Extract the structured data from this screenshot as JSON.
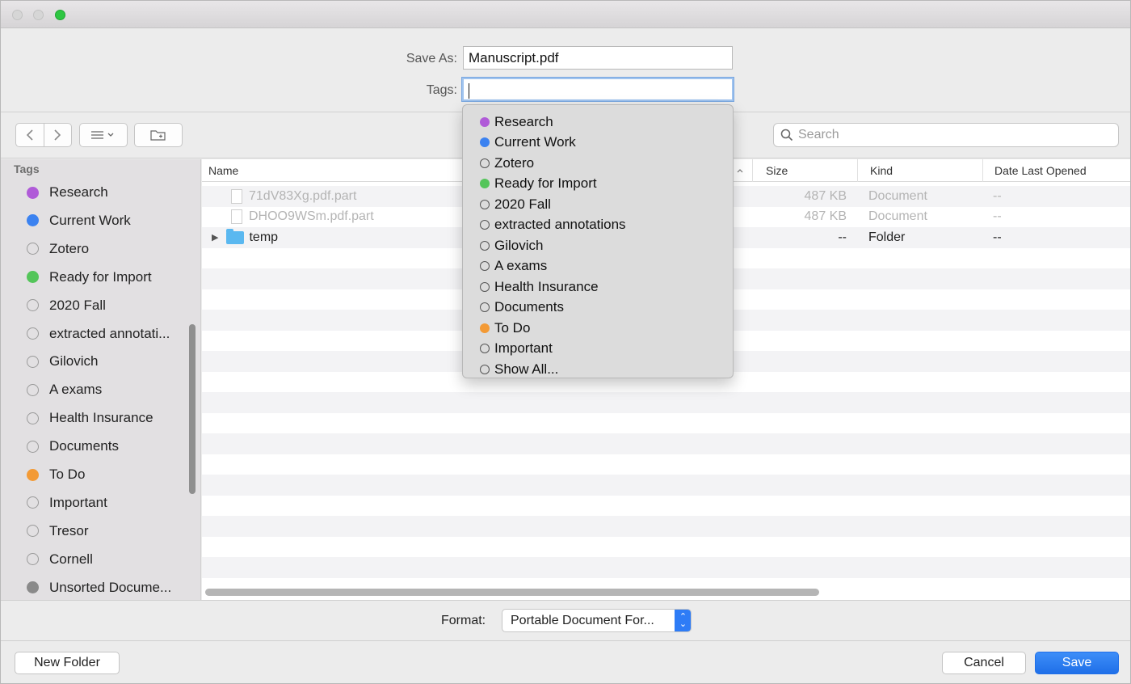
{
  "header": {
    "save_as_label": "Save As:",
    "save_as_value": "Manuscript.pdf",
    "tags_label": "Tags:",
    "tags_value": ""
  },
  "toolbar": {
    "search_placeholder": "Search"
  },
  "sidebar": {
    "title": "Tags",
    "items": [
      {
        "label": "Research",
        "color": "#b05bd8"
      },
      {
        "label": "Current Work",
        "color": "#3b82f0"
      },
      {
        "label": "Zotero",
        "color": ""
      },
      {
        "label": "Ready for Import",
        "color": "#54c55a"
      },
      {
        "label": "2020 Fall",
        "color": ""
      },
      {
        "label": "extracted annotati...",
        "color": ""
      },
      {
        "label": "Gilovich",
        "color": ""
      },
      {
        "label": "A exams",
        "color": ""
      },
      {
        "label": "Health Insurance",
        "color": ""
      },
      {
        "label": "Documents",
        "color": ""
      },
      {
        "label": "To Do",
        "color": "#f39a35"
      },
      {
        "label": "Important",
        "color": ""
      },
      {
        "label": "Tresor",
        "color": ""
      },
      {
        "label": "Cornell",
        "color": ""
      },
      {
        "label": "Unsorted Docume...",
        "color": "#8a8a8a"
      }
    ]
  },
  "columns": {
    "name": "Name",
    "size": "Size",
    "kind": "Kind",
    "date": "Date Last Opened"
  },
  "files": [
    {
      "name": "71dV83Xg.pdf.part",
      "size": "487 KB",
      "kind": "Document",
      "date": "--",
      "type": "file",
      "dimmed": true
    },
    {
      "name": "DHOO9WSm.pdf.part",
      "size": "487 KB",
      "kind": "Document",
      "date": "--",
      "type": "file",
      "dimmed": true
    },
    {
      "name": "temp",
      "size": "--",
      "kind": "Folder",
      "date": "--",
      "type": "folder",
      "dimmed": false
    }
  ],
  "tag_popup": {
    "items": [
      {
        "label": "Research",
        "color": "#b05bd8"
      },
      {
        "label": "Current Work",
        "color": "#3b82f0"
      },
      {
        "label": "Zotero",
        "color": ""
      },
      {
        "label": "Ready for Import",
        "color": "#54c55a"
      },
      {
        "label": "2020 Fall",
        "color": ""
      },
      {
        "label": "extracted annotations",
        "color": ""
      },
      {
        "label": "Gilovich",
        "color": ""
      },
      {
        "label": "A exams",
        "color": ""
      },
      {
        "label": "Health Insurance",
        "color": ""
      },
      {
        "label": "Documents",
        "color": ""
      },
      {
        "label": "To Do",
        "color": "#f39a35"
      },
      {
        "label": "Important",
        "color": ""
      },
      {
        "label": "Show All...",
        "color": ""
      }
    ]
  },
  "footer": {
    "format_label": "Format:",
    "format_value": "Portable Document For...",
    "new_folder_label": "New Folder",
    "cancel_label": "Cancel",
    "save_label": "Save"
  },
  "colors": {
    "accent": "#2e7cf6",
    "folder": "#5ab8f0"
  }
}
